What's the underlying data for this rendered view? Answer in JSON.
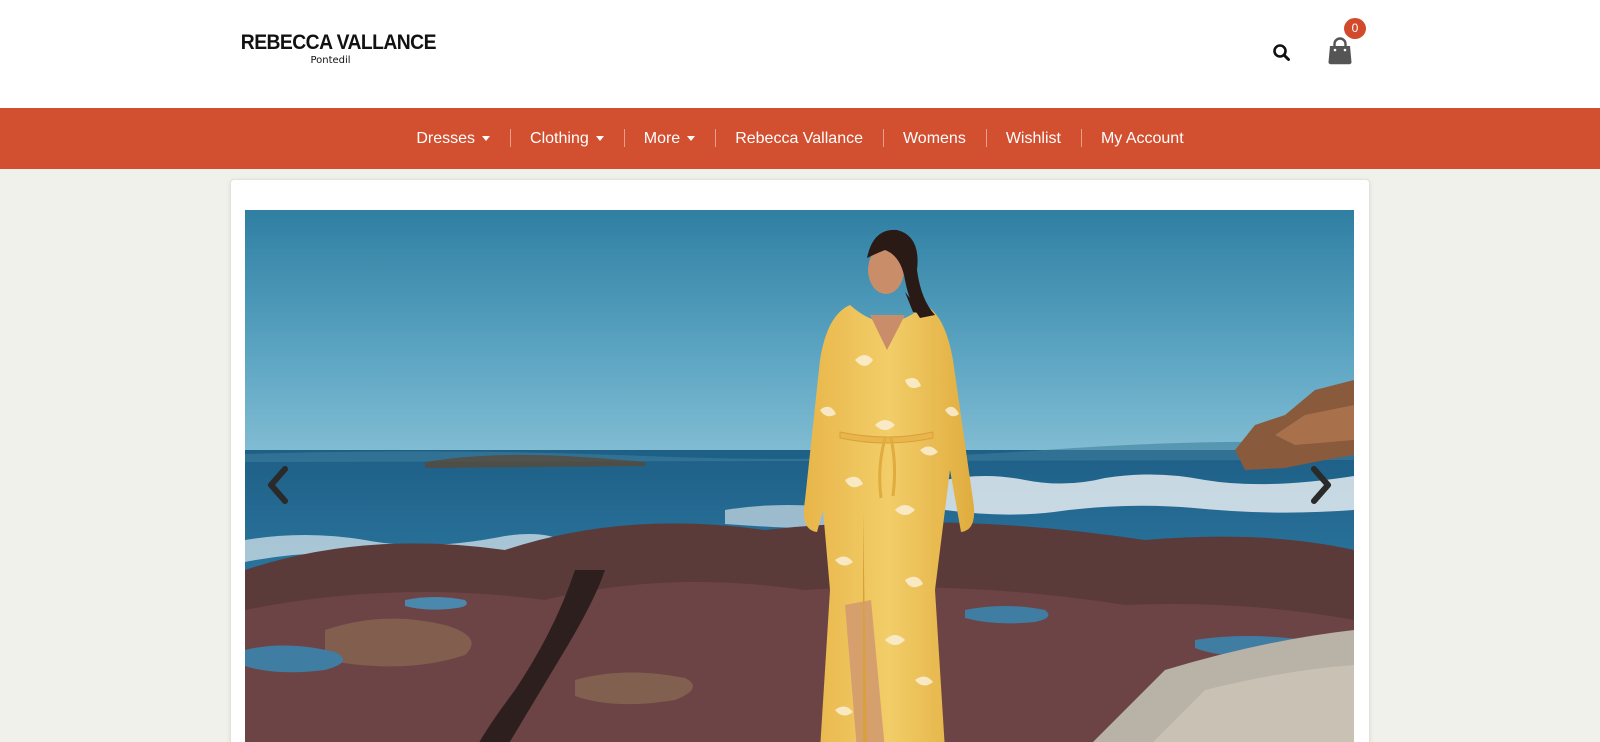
{
  "brand": {
    "name": "REBECCA VALLANCE",
    "subtitle": "Pontedil"
  },
  "header": {
    "search_icon": "search-icon",
    "cart_icon": "shopping-bag-icon",
    "cart_count": "0"
  },
  "nav": {
    "items": [
      {
        "label": "Dresses",
        "dropdown": true
      },
      {
        "label": "Clothing",
        "dropdown": true
      },
      {
        "label": "More",
        "dropdown": true
      },
      {
        "label": "Rebecca Vallance",
        "dropdown": false
      },
      {
        "label": "Womens",
        "dropdown": false
      },
      {
        "label": "Wishlist",
        "dropdown": false
      },
      {
        "label": "My Account",
        "dropdown": false
      }
    ]
  },
  "carousel": {
    "prev_icon": "chevron-left-icon",
    "next_icon": "chevron-right-icon",
    "image": "model-in-yellow-floral-maxi-dress-on-rocky-seashore"
  },
  "colors": {
    "nav_bg": "#d24f30",
    "badge_bg": "#d24a2c",
    "page_bg": "#f1f1ec",
    "header_bg": "#ffffff"
  }
}
